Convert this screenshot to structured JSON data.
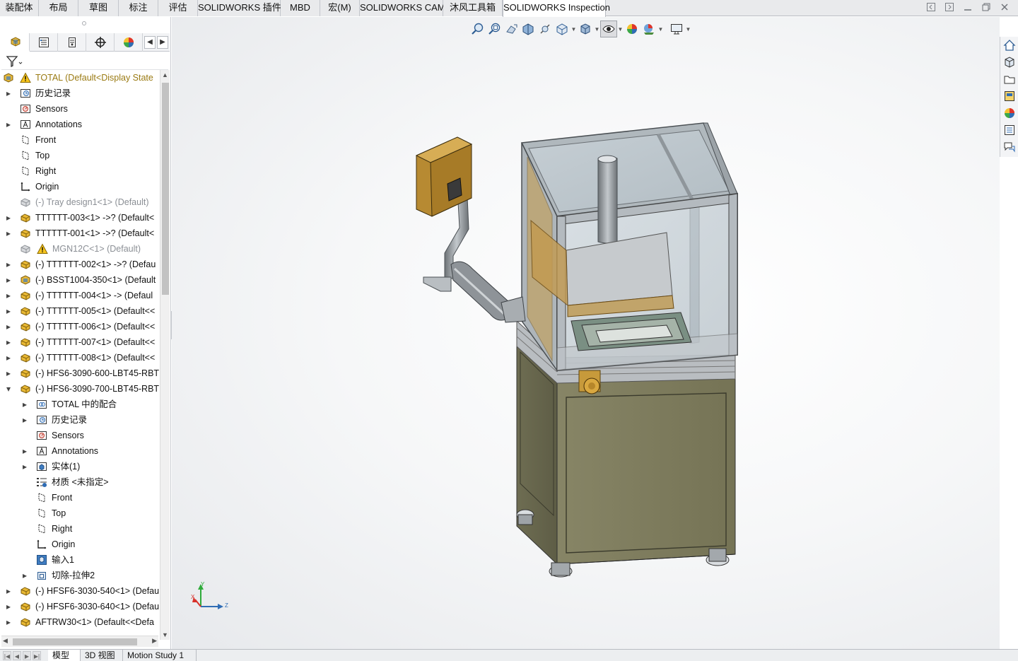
{
  "ribbon_tabs": [
    {
      "label": "装配体"
    },
    {
      "label": "布局"
    },
    {
      "label": "草图"
    },
    {
      "label": "标注"
    },
    {
      "label": "评估"
    },
    {
      "label": "SOLIDWORKS 插件"
    },
    {
      "label": "MBD"
    },
    {
      "label": "宏(M)"
    },
    {
      "label": "SOLIDWORKS CAM"
    },
    {
      "label": "沐风工具箱"
    },
    {
      "label": "SOLIDWORKS Inspection"
    }
  ],
  "active_ribbon_tab": "SOLIDWORKS Inspection",
  "window_controls": [
    "restore-left-icon",
    "restore-right-icon",
    "minimize-icon",
    "maximize-icon",
    "close-icon"
  ],
  "panel_tabs": [
    "featuremanager-icon",
    "propertymanager-icon",
    "configurationmanager-icon",
    "dimxpert-icon",
    "displaymanager-icon"
  ],
  "tree": {
    "root": "TOTAL  (Default<Display State",
    "items": [
      {
        "label": "历史记录",
        "icon": "history-icon",
        "expand": true,
        "indent": 0
      },
      {
        "label": "Sensors",
        "icon": "sensors-icon",
        "expand": false,
        "indent": 0
      },
      {
        "label": "Annotations",
        "icon": "annotations-icon",
        "expand": true,
        "indent": 0
      },
      {
        "label": "Front",
        "icon": "plane-icon",
        "expand": false,
        "indent": 0
      },
      {
        "label": "Top",
        "icon": "plane-icon",
        "expand": false,
        "indent": 0
      },
      {
        "label": "Right",
        "icon": "plane-icon",
        "expand": false,
        "indent": 0
      },
      {
        "label": "Origin",
        "icon": "origin-icon",
        "expand": false,
        "indent": 0
      },
      {
        "label": "(-) Tray design1<1> (Default)",
        "icon": "part-suppressed-icon",
        "expand": false,
        "indent": 0,
        "dim": true
      },
      {
        "label": "TTTTTT-003<1> ->? (Default<",
        "icon": "part-icon",
        "expand": true,
        "indent": 0
      },
      {
        "label": "TTTTTT-001<1> ->? (Default<",
        "icon": "part-icon",
        "expand": true,
        "indent": 0
      },
      {
        "label": "MGN12C<1> (Default)",
        "icon": "part-suppressed-icon",
        "warn": true,
        "expand": false,
        "indent": 0,
        "dim": true
      },
      {
        "label": "(-) TTTTTT-002<1> ->? (Defau",
        "icon": "part-icon",
        "expand": true,
        "indent": 0
      },
      {
        "label": "(-) BSST1004-350<1> (Default",
        "icon": "assembly-icon",
        "expand": true,
        "indent": 0
      },
      {
        "label": "(-) TTTTTT-004<1> -> (Defaul",
        "icon": "part-icon",
        "expand": true,
        "indent": 0
      },
      {
        "label": "(-) TTTTTT-005<1> (Default<<",
        "icon": "part-icon",
        "expand": true,
        "indent": 0
      },
      {
        "label": "(-) TTTTTT-006<1> (Default<<",
        "icon": "part-icon",
        "expand": true,
        "indent": 0
      },
      {
        "label": "(-) TTTTTT-007<1> (Default<<",
        "icon": "part-icon",
        "expand": true,
        "indent": 0
      },
      {
        "label": "(-) TTTTTT-008<1> (Default<<",
        "icon": "part-icon",
        "expand": true,
        "indent": 0
      },
      {
        "label": "(-) HFS6-3090-600-LBT45-RBT",
        "icon": "part-icon",
        "expand": true,
        "indent": 0
      },
      {
        "label": "(-) HFS6-3090-700-LBT45-RBT",
        "icon": "part-icon",
        "expand": "open",
        "indent": 0
      },
      {
        "label": "TOTAL 中的配合",
        "icon": "mates-icon",
        "expand": true,
        "indent": 1
      },
      {
        "label": "历史记录",
        "icon": "history-icon",
        "expand": true,
        "indent": 1
      },
      {
        "label": "Sensors",
        "icon": "sensors-icon",
        "expand": false,
        "indent": 1
      },
      {
        "label": "Annotations",
        "icon": "annotations-icon",
        "expand": true,
        "indent": 1
      },
      {
        "label": "实体(1)",
        "icon": "solid-bodies-icon",
        "expand": true,
        "indent": 1
      },
      {
        "label": "材质 <未指定>",
        "icon": "material-icon",
        "expand": false,
        "indent": 1
      },
      {
        "label": "Front",
        "icon": "plane-icon",
        "expand": false,
        "indent": 1
      },
      {
        "label": "Top",
        "icon": "plane-icon",
        "expand": false,
        "indent": 1
      },
      {
        "label": "Right",
        "icon": "plane-icon",
        "expand": false,
        "indent": 1
      },
      {
        "label": "Origin",
        "icon": "origin-icon",
        "expand": false,
        "indent": 1
      },
      {
        "label": "输入1",
        "icon": "imported-icon",
        "expand": false,
        "indent": 1
      },
      {
        "label": "切除-拉伸2",
        "icon": "cut-extrude-icon",
        "expand": true,
        "indent": 1
      },
      {
        "label": "(-) HFSF6-3030-540<1> (Defau",
        "icon": "part-icon",
        "expand": true,
        "indent": 0
      },
      {
        "label": "(-) HFSF6-3030-640<1> (Defau",
        "icon": "part-icon",
        "expand": true,
        "indent": 0
      },
      {
        "label": "AFTRW30<1> (Default<<Defa",
        "icon": "part-icon",
        "expand": true,
        "indent": 0
      }
    ]
  },
  "hud_tools": [
    "zoom-to-fit-icon",
    "zoom-to-area-icon",
    "previous-view-icon",
    "section-view-icon",
    "dynamic-annotation-icon",
    "view-orientation-icon",
    "display-style-icon",
    "hide-show-items-icon",
    "edit-appearance-icon",
    "apply-scene-icon",
    "view-settings-icon"
  ],
  "task_pane": [
    "home-icon",
    "design-library-icon",
    "file-explorer-icon",
    "view-palette-icon",
    "appearances-icon",
    "custom-properties-icon",
    "forum-icon"
  ],
  "bottom_tabs": [
    {
      "label": "模型",
      "active": true
    },
    {
      "label": "3D 视图",
      "active": false
    },
    {
      "label": "Motion Study 1",
      "active": false
    }
  ],
  "triad": {
    "y": "Y",
    "z": "Z",
    "x": "X"
  },
  "colors": {
    "frame_green": "#7d7b5c",
    "glass": "#c8d1d6",
    "aluminum": "#b8bcc0",
    "monitor_gold": "#c99a3c",
    "accent_blue": "#2f6db5"
  }
}
